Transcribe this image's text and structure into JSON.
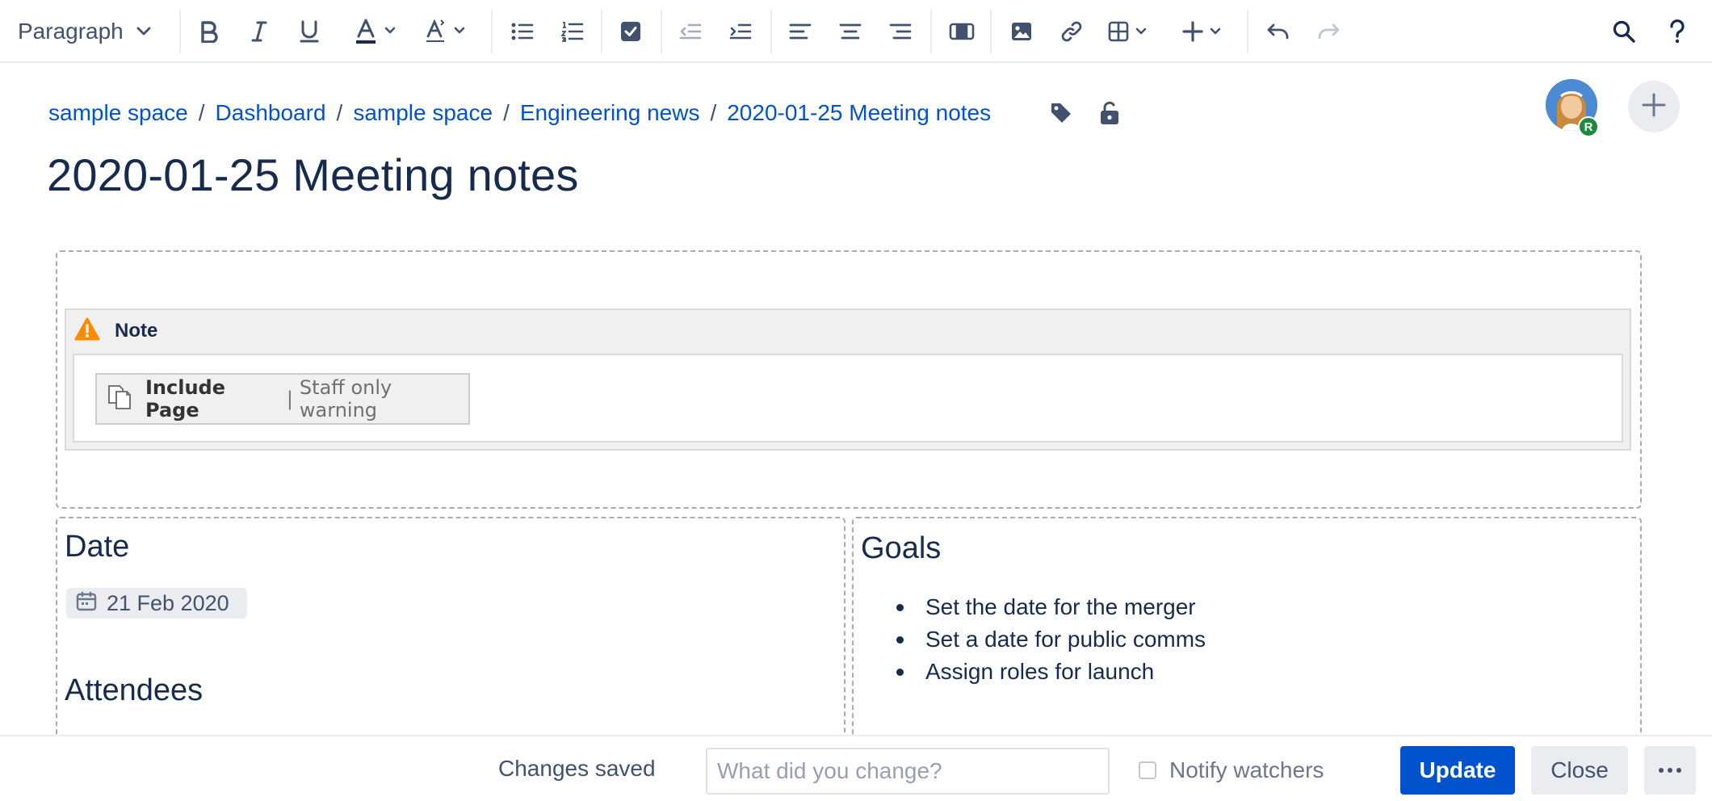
{
  "toolbar": {
    "paragraph_style": "Paragraph",
    "buttons": [
      "bold-icon",
      "italic-icon",
      "underline-icon",
      "text-color-icon",
      "clear-formatting-icon",
      "bullet-list-icon",
      "numbered-list-icon",
      "task-list-icon",
      "outdent-icon",
      "indent-icon",
      "align-left-icon",
      "align-center-icon",
      "align-right-icon",
      "page-layout-icon",
      "image-icon",
      "link-icon",
      "table-icon",
      "insert-more-icon",
      "undo-icon",
      "redo-icon",
      "search-icon",
      "help-icon"
    ]
  },
  "breadcrumb": {
    "items": [
      "sample space",
      "Dashboard",
      "sample space",
      "Engineering news",
      "2020-01-25 Meeting notes"
    ],
    "separator": "/"
  },
  "collaborator": {
    "badge": "R"
  },
  "page": {
    "title": "2020-01-25 Meeting notes"
  },
  "note_macro": {
    "label": "Note",
    "include_page": {
      "name": "Include Page",
      "separator": "|",
      "param": "Staff only warning"
    }
  },
  "left_column": {
    "date_heading": "Date",
    "date_value": "21 Feb 2020",
    "attendees_heading": "Attendees"
  },
  "right_column": {
    "goals_heading": "Goals",
    "goals": [
      "Set the date for the merger",
      "Set a date for public comms",
      "Assign roles for launch"
    ]
  },
  "footer": {
    "status": "Changes saved",
    "change_placeholder": "What did you change?",
    "notify_label": "Notify watchers",
    "update_label": "Update",
    "close_label": "Close"
  },
  "colors": {
    "accent": "#0052CC",
    "text": "#172B4D",
    "warning": "#FF8B00",
    "badge": "#1F8A3B"
  }
}
